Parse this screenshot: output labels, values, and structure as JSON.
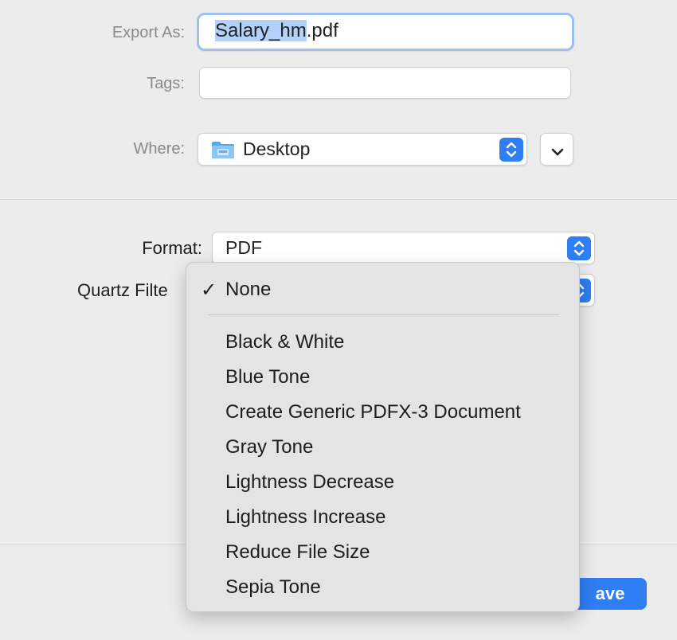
{
  "export": {
    "label": "Export As:",
    "filename_selected": "Salary_hm",
    "filename_ext": ".pdf"
  },
  "tags": {
    "label": "Tags:",
    "value": ""
  },
  "where": {
    "label": "Where:",
    "value": "Desktop",
    "icon": "folder-icon"
  },
  "format": {
    "label": "Format:",
    "value": "PDF"
  },
  "quartz_filter": {
    "label": "Quartz Filte",
    "selected": "None",
    "options": [
      "Black & White",
      "Blue Tone",
      "Create Generic PDFX-3 Document",
      "Gray Tone",
      "Lightness Decrease",
      "Lightness Increase",
      "Reduce File Size",
      "Sepia Tone"
    ]
  },
  "buttons": {
    "save_label_visible": "ave"
  },
  "colors": {
    "accent": "#2f7ef5",
    "selection": "#b2d2fb",
    "focus_ring": "#9ec0f5"
  }
}
